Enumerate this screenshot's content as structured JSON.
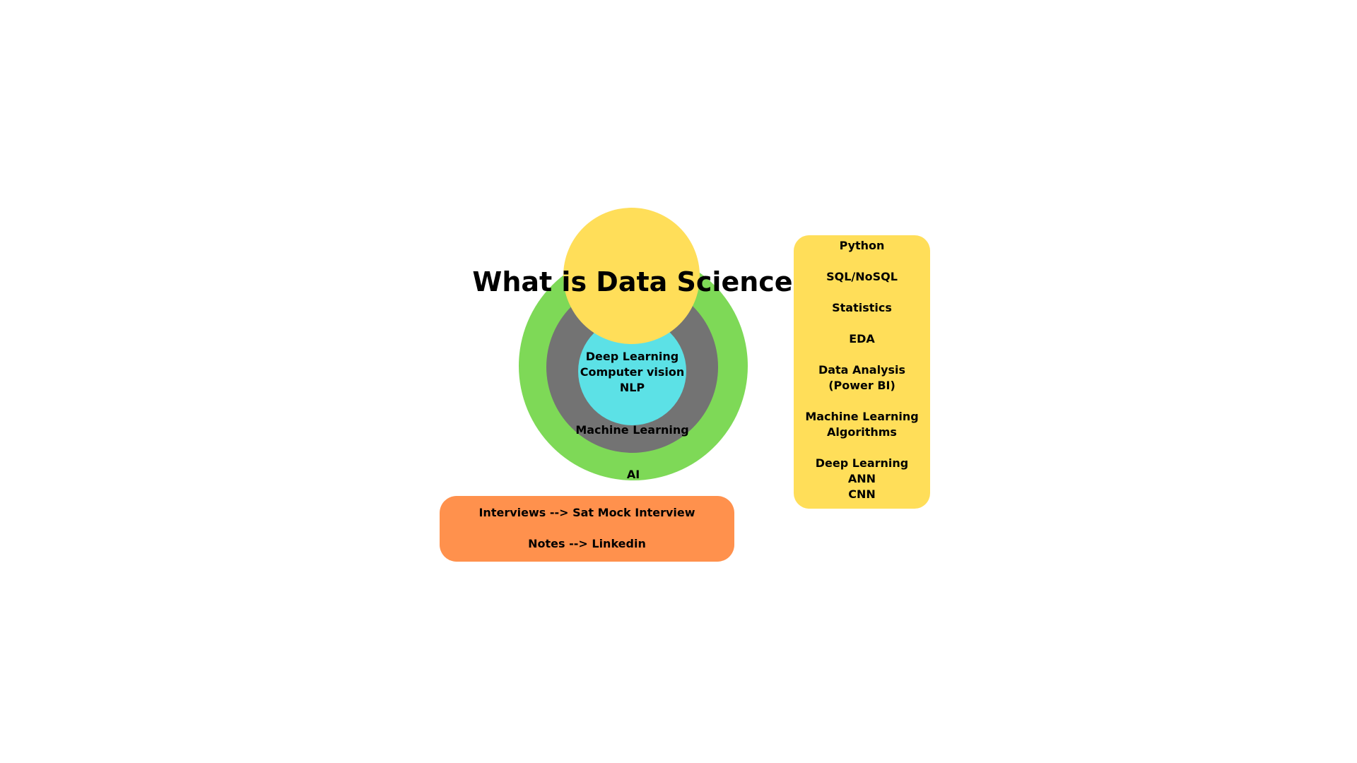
{
  "title": "What is Data Science",
  "diagram": {
    "outer_label": "AI",
    "middle_label": "Machine Learning",
    "inner_lines": [
      "Deep Learning",
      "Computer vision",
      "NLP"
    ]
  },
  "skills": [
    [
      "Python"
    ],
    [
      "SQL/NoSQL"
    ],
    [
      "Statistics"
    ],
    [
      "EDA"
    ],
    [
      "Data Analysis",
      "(Power BI)"
    ],
    [
      "Machine Learning",
      "Algorithms"
    ],
    [
      "Deep Learning",
      "ANN",
      "CNN"
    ]
  ],
  "notes": {
    "interviews": "Interviews --> Sat Mock Interview",
    "notes": "Notes --> Linkedin"
  },
  "colors": {
    "ai": "#7ed957",
    "machine_learning": "#737373",
    "deep_learning": "#5ce1e6",
    "data_science": "#ffde59",
    "skills_box": "#ffde59",
    "notes_box": "#ff914d"
  }
}
